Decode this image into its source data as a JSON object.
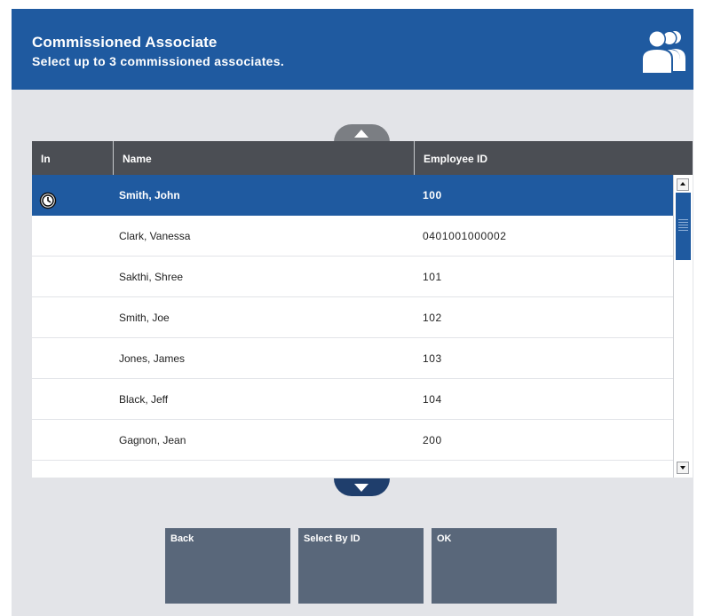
{
  "header": {
    "title": "Commissioned Associate",
    "subtitle": "Select up to 3 commissioned associates.",
    "icon": "associates-icon"
  },
  "table": {
    "columns": [
      "In",
      "Name",
      "Employee ID"
    ],
    "rows": [
      {
        "in_icon": "clock-icon",
        "name": "Smith, John",
        "employee_id": "100",
        "selected": true
      },
      {
        "in_icon": "",
        "name": "Clark, Vanessa",
        "employee_id": "0401001000002",
        "selected": false
      },
      {
        "in_icon": "",
        "name": "Sakthi, Shree",
        "employee_id": "101",
        "selected": false
      },
      {
        "in_icon": "",
        "name": "Smith, Joe",
        "employee_id": "102",
        "selected": false
      },
      {
        "in_icon": "",
        "name": "Jones, James",
        "employee_id": "103",
        "selected": false
      },
      {
        "in_icon": "",
        "name": "Black, Jeff",
        "employee_id": "104",
        "selected": false
      },
      {
        "in_icon": "",
        "name": "Gagnon, Jean",
        "employee_id": "200",
        "selected": false
      },
      {
        "in_icon": "",
        "name": "",
        "employee_id": "",
        "selected": false
      }
    ]
  },
  "buttons": {
    "back": "Back",
    "select_by_id": "Select By ID",
    "ok": "OK"
  },
  "colors": {
    "header_bg": "#1f5aa0",
    "selected_row": "#1f5aa0",
    "table_header": "#4b4e54",
    "button_bg": "#59677a",
    "page_bg": "#e3e4e8"
  }
}
